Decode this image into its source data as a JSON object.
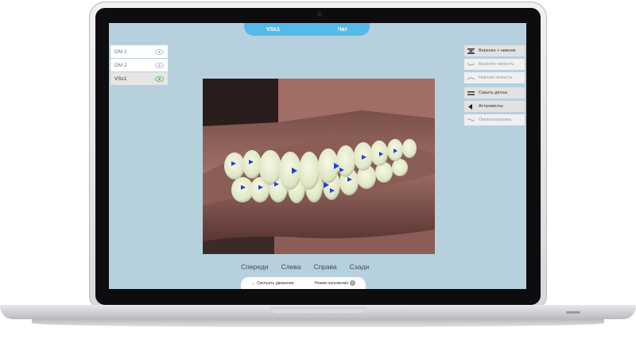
{
  "window": {
    "title": "VSc1",
    "chat_label": "Чат"
  },
  "left_list": {
    "items": [
      {
        "label": "DM 1",
        "active": false
      },
      {
        "label": "DM 2",
        "active": false
      },
      {
        "label": "VSc1",
        "active": true
      }
    ]
  },
  "right_panel": {
    "items": [
      {
        "label": "Верхняя + нижняя",
        "icon": "both-jaws-icon",
        "active": true
      },
      {
        "label": "Верхняя челюсть",
        "icon": "upper-jaw-icon",
        "active": false
      },
      {
        "label": "Нижняя челюсть",
        "icon": "lower-jaw-icon",
        "active": false
      },
      {
        "label": "Скрыть дёсны",
        "icon": "hide-gums-icon",
        "active": true
      },
      {
        "label": "Аттачменты",
        "icon": "attachments-icon",
        "active": true
      },
      {
        "label": "Окклюзограмма",
        "icon": "occlusogram-icon",
        "active": false
      }
    ]
  },
  "view_tabs": [
    "Спереди",
    "Слева",
    "Справа",
    "Сзади"
  ],
  "bottom_bar": {
    "view_movements": "Смотреть движения",
    "overlay_mode": "Режим наложения"
  },
  "colors": {
    "accent": "#55b9ea",
    "screen_bg": "#b7d0de",
    "gum": "#8a5e57",
    "tooth": "#dfe6c4",
    "attachment": "#2a3dd0"
  }
}
